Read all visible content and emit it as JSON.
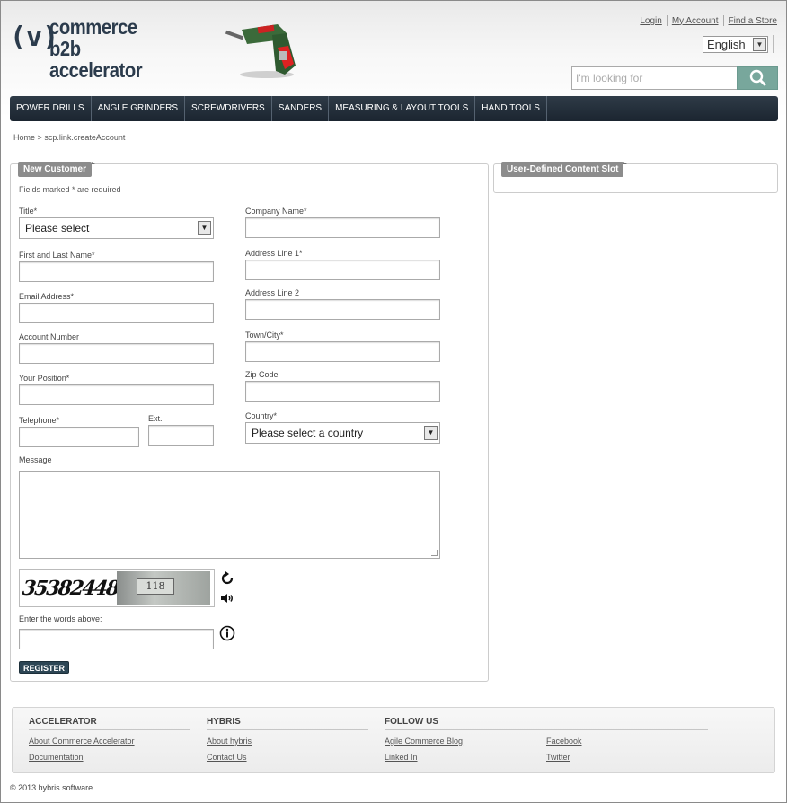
{
  "header": {
    "logo_mark": "(v)",
    "logo_line1": "commerce",
    "logo_line2": "b2b accelerator",
    "top_links": [
      "Login",
      "My Account",
      "Find a Store"
    ],
    "language": "English",
    "search_placeholder": "I'm looking for"
  },
  "nav": {
    "items": [
      "POWER DRILLS",
      "ANGLE GRINDERS",
      "SCREWDRIVERS",
      "SANDERS",
      "MEASURING & LAYOUT TOOLS",
      "HAND TOOLS"
    ]
  },
  "breadcrumb": {
    "home": "Home",
    "separator": ">",
    "current": "scp.link.createAccount"
  },
  "form": {
    "panel_title": "New Customer",
    "required_note": "Fields marked * are required",
    "title_label": "Title*",
    "title_value": "Please select",
    "name_label": "First and Last Name*",
    "email_label": "Email Address*",
    "account_label": "Account Number",
    "position_label": "Your Position*",
    "telephone_label": "Telephone*",
    "ext_label": "Ext.",
    "company_label": "Company Name*",
    "address1_label": "Address Line 1*",
    "address2_label": "Address Line 2",
    "town_label": "Town/City*",
    "zip_label": "Zip Code",
    "country_label": "Country*",
    "country_value": "Please select a country",
    "message_label": "Message",
    "captcha_text": "35382448",
    "captcha_plate": "118",
    "captcha_prompt": "Enter the words above:",
    "register_label": "REGISTER"
  },
  "side_panel": {
    "title": "User-Defined Content Slot"
  },
  "footer": {
    "columns": [
      {
        "title": "ACCELERATOR",
        "links": [
          "About Commerce Accelerator",
          "Documentation"
        ]
      },
      {
        "title": "HYBRIS",
        "links": [
          "About hybris",
          "Contact Us"
        ]
      },
      {
        "title": "FOLLOW US",
        "links": [
          "Agile Commerce Blog",
          "Linked In",
          "Facebook",
          "Twitter"
        ]
      }
    ],
    "copyright": "© 2013 hybris software"
  },
  "colors": {
    "nav_bg": "#1b2530",
    "search_button": "#78a79c",
    "panel_tag": "#8c8c8c",
    "register_button": "#2d4655"
  }
}
